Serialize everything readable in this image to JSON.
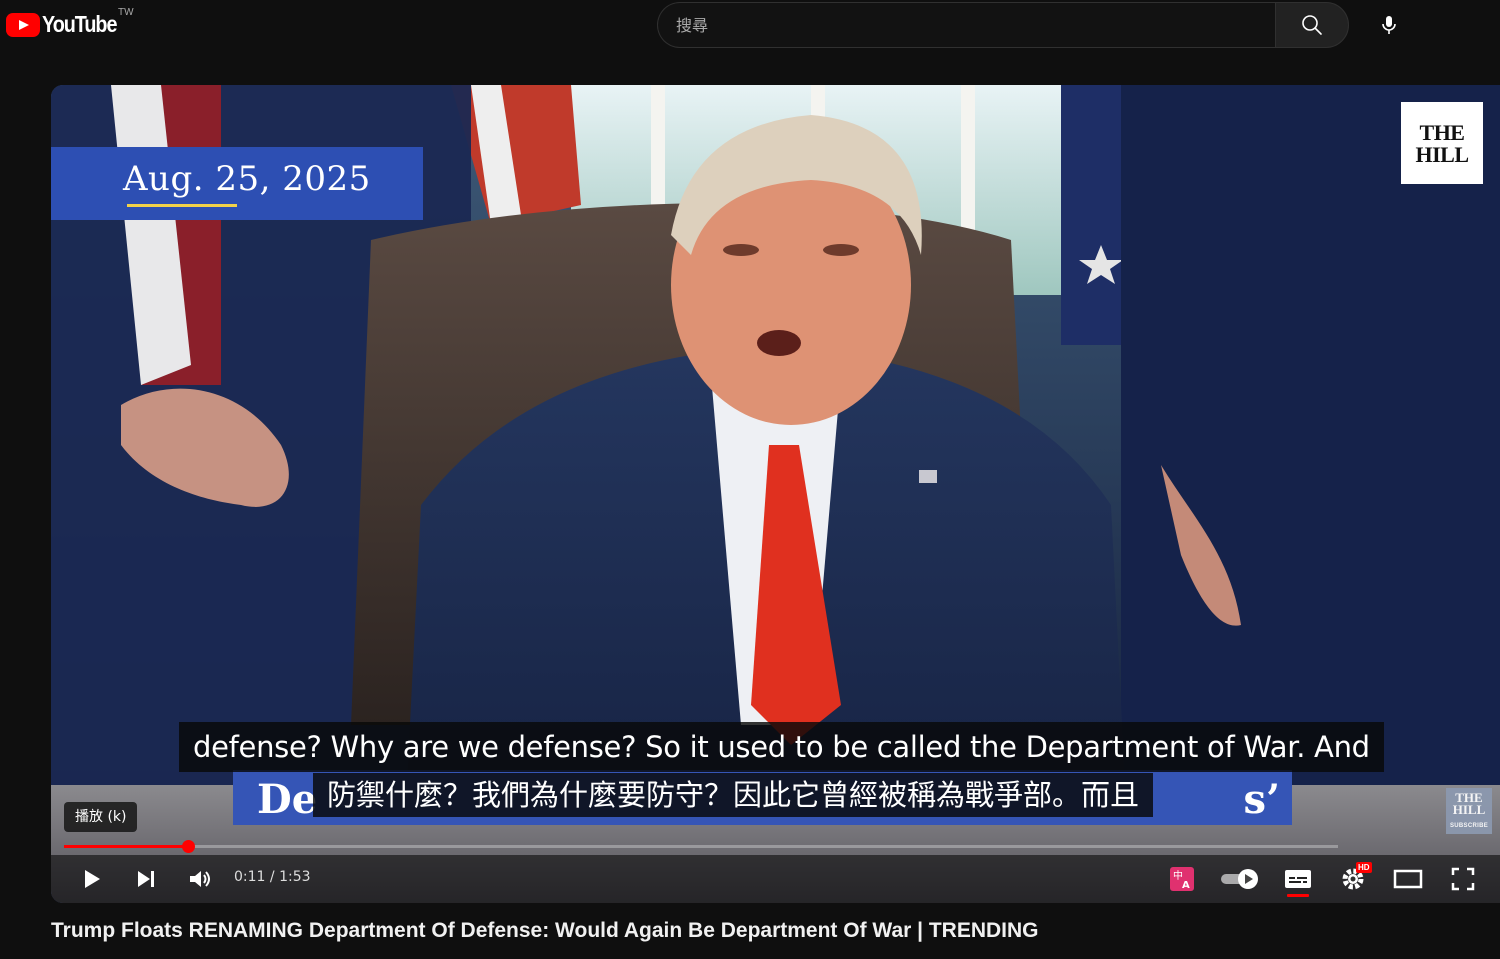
{
  "app": {
    "logo_text": "YouTube",
    "region": "TW"
  },
  "search": {
    "placeholder": "搜尋"
  },
  "video": {
    "date_label": "Aug. 25, 2025",
    "channel_logo_text": "THE HILL",
    "channel_mini_logo_text": "THE HILL",
    "channel_mini_sub": "SUBSCRIBE",
    "lower_third_prefix": "De",
    "lower_third_suffix": "s’",
    "caption_en": "defense? Why are we defense? So it used to be called the Department of War. And",
    "caption_zh": "防禦什麼？我們為什麼要防守？因此它曾經被稱為戰爭部。而且",
    "play_tooltip": "播放 (k)",
    "current_time": "0:11",
    "duration": "1:53",
    "progress_fraction": 0.097,
    "title": "Trump Floats RENAMING Department Of Defense: Would Again Be Department Of War | TRENDING"
  },
  "colors": {
    "brand_red": "#ff0000",
    "accent_blue": "#2d4fb3",
    "date_underline": "#f2d24a"
  }
}
